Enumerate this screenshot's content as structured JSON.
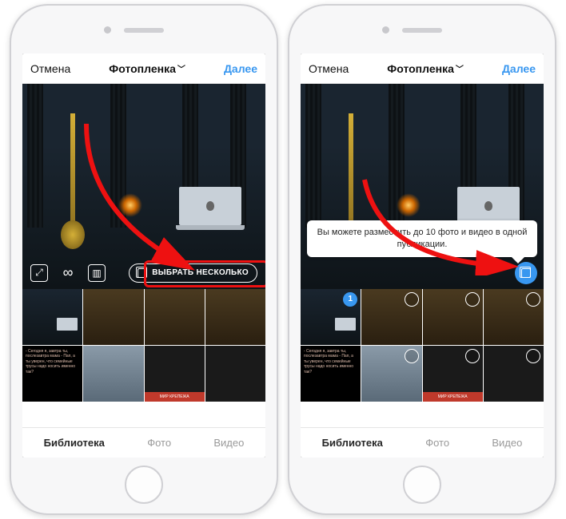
{
  "left": {
    "topbar": {
      "cancel": "Отмена",
      "title": "Фотопленка",
      "next": "Далее"
    },
    "controls": {
      "select_multiple_label": "ВЫБРАТЬ НЕСКОЛЬКО"
    },
    "bottombar": {
      "library": "Библиотека",
      "photo": "Фото",
      "video": "Видео"
    },
    "thumb_text": "- Сегодня я, завтра ты, послезавтра мама\n- Пап, а ты уверен, что семейные трусы надо носить именно так?",
    "banner": "МИР КРЕПЕЖА"
  },
  "right": {
    "topbar": {
      "cancel": "Отмена",
      "title": "Фотопленка",
      "next": "Далее"
    },
    "tooltip": "Вы можете разместить до 10 фото и видео в одной публикации.",
    "selected_badge": "1",
    "bottombar": {
      "library": "Библиотека",
      "photo": "Фото",
      "video": "Видео"
    },
    "thumb_text": "- Сегодня я, завтра ты, послезавтра мама\n- Пап, а ты уверен, что семейные трусы надо носить именно так?",
    "banner": "МИР КРЕПЕЖА"
  }
}
